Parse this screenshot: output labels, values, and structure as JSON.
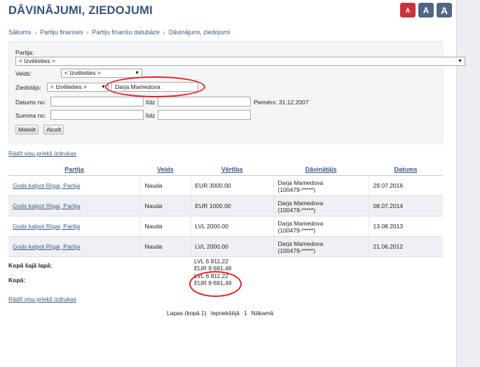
{
  "header": {
    "title": "DĀVINĀJUMI, ZIEDOJUMI",
    "font_buttons": [
      "A",
      "A",
      "A"
    ]
  },
  "breadcrumb": [
    "Sākums",
    "Partiju finanses",
    "Partiju finanšu datubāze",
    "Dāvinājumi, ziedojumi"
  ],
  "search": {
    "party_label": "Partija:",
    "party_value": "< Izvēlieties >",
    "type_label": "Veids:",
    "type_value": "< Izvēlieties >",
    "donor_label": "Ziedotājs:",
    "donor_select_value": "< Izvēlieties >",
    "donor_input_value": "Darja Mamedova",
    "date_from_label": "Datums no:",
    "date_to_label": "līdz",
    "date_example": "Piemērs: 31.12.2007",
    "sum_from_label": "Summa no:",
    "sum_to_label": "līdz",
    "search_button": "Meklēt",
    "cancel_button": "Atcelt"
  },
  "print_link": "Rādīt visu priekš izdrukas",
  "table": {
    "columns": [
      "Partija",
      "Veids",
      "Vērtība",
      "Dāvinātājs",
      "Datums"
    ],
    "rows": [
      {
        "party": "Gods kalpot Rīgai, Partija",
        "type": "Nauda",
        "value": "EUR 3000.00",
        "donor_name": "Darja Mamedova",
        "donor_id": "(100479-*****)",
        "date": "29.07.2016"
      },
      {
        "party": "Gods kalpot Rīgai, Partija",
        "type": "Nauda",
        "value": "EUR 1000.00",
        "donor_name": "Darja Mamedova",
        "donor_id": "(100479-*****)",
        "date": "08.07.2014"
      },
      {
        "party": "Gods kalpot Rīgai, Partija",
        "type": "Nauda",
        "value": "LVL 2000.00",
        "donor_name": "Darja Mamedova",
        "donor_id": "(100479-*****)",
        "date": "13.08.2013"
      },
      {
        "party": "Gods kalpot Rīgai, Partija",
        "type": "Nauda",
        "value": "LVL 2000.00",
        "donor_name": "Darja Mamedova",
        "donor_id": "(100479-*****)",
        "date": "21.06.2012"
      }
    ]
  },
  "totals": {
    "page_label": "Kopā šajā lapā:",
    "page_lvl": "LVL 6 811,22",
    "page_eur": "EUR 9 691,49",
    "all_label": "Kopā:",
    "all_lvl": "LVL 6 811,22",
    "all_eur": "EUR 9 691,49"
  },
  "pager": {
    "pages_text": "Lapas (kopā 1)",
    "prev": "Iepriekšējā",
    "current": "1",
    "next": "Nākamā"
  },
  "colors": {
    "annotation": "#e0242a",
    "accent": "#36537a",
    "link": "#3a5a85"
  }
}
